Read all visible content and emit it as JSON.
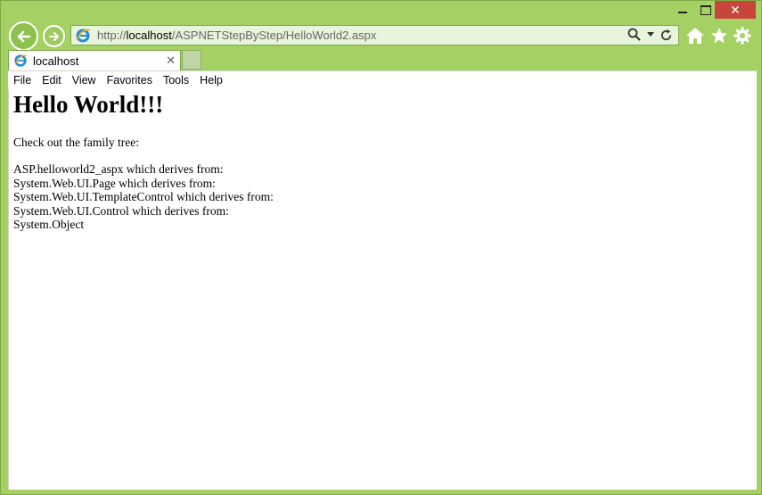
{
  "window": {
    "close_glyph": "✕"
  },
  "address_bar": {
    "url_prefix": "http://",
    "url_host": "localhost",
    "url_path": "/ASPNETStepByStep/HelloWorld2.aspx"
  },
  "tabs": [
    {
      "title": "localhost",
      "close_glyph": "✕"
    }
  ],
  "menu": [
    "File",
    "Edit",
    "View",
    "Favorites",
    "Tools",
    "Help"
  ],
  "page": {
    "heading": "Hello World!!!",
    "intro": "Check out the family tree:",
    "tree": [
      "ASP.helloworld2_aspx which derives from:",
      "System.Web.UI.Page which derives from:",
      "System.Web.UI.TemplateControl which derives from:",
      "System.Web.UI.Control which derives from:",
      "System.Object"
    ]
  },
  "icons": {
    "back": "back-arrow-icon",
    "forward": "forward-arrow-icon",
    "search": "search-icon",
    "dropdown": "chevron-down-icon",
    "refresh": "refresh-icon",
    "home": "home-icon",
    "favorites": "star-icon",
    "settings": "gear-icon"
  },
  "colors": {
    "frame": "#9dcb5e",
    "close_button": "#c7453a"
  }
}
